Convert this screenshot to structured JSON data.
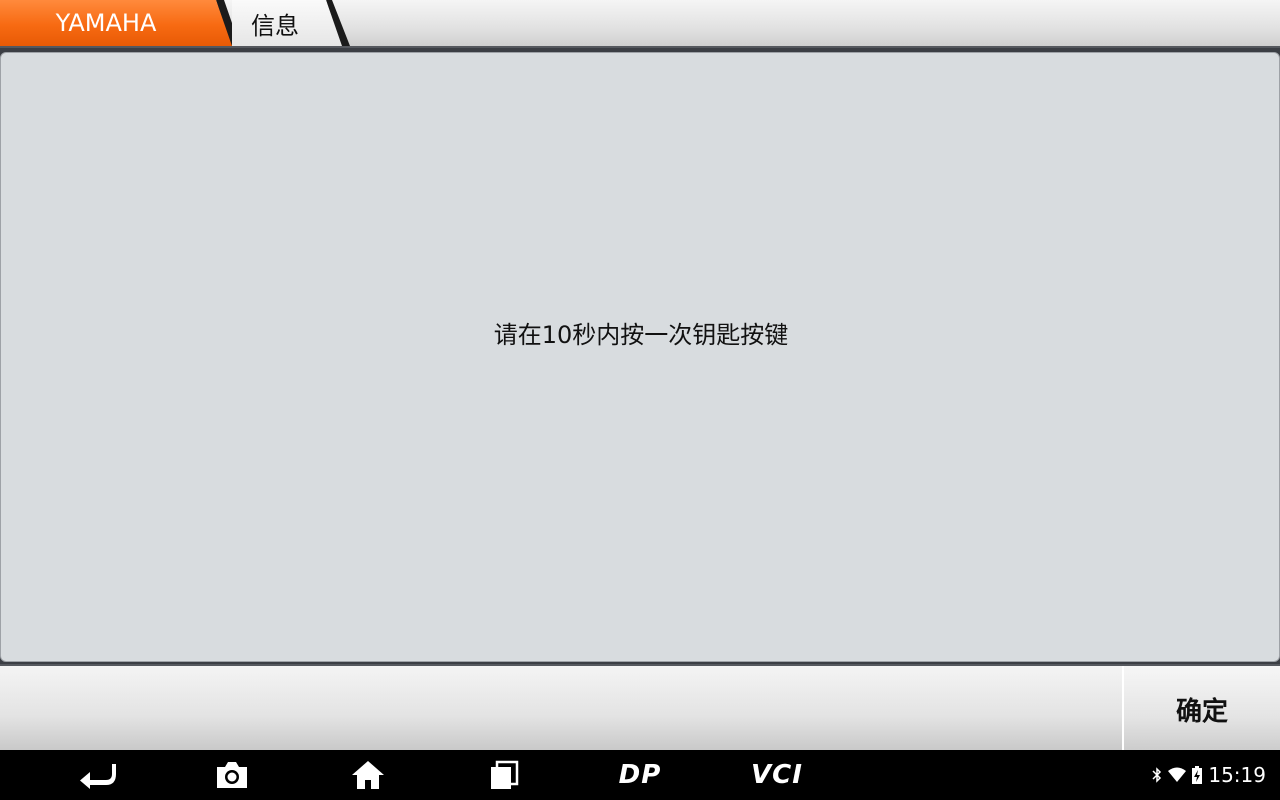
{
  "breadcrumb": {
    "items": [
      {
        "label": "YAMAHA",
        "color": "#f76a12"
      },
      {
        "label": "信息"
      }
    ]
  },
  "main": {
    "message": "请在10秒内按一次钥匙按键"
  },
  "actions": {
    "confirm_label": "确定"
  },
  "navbar": {
    "buttons": [
      "back-icon",
      "camera-icon",
      "home-icon",
      "recents-icon",
      "dp-icon",
      "vci-icon"
    ],
    "dp_label": "DP",
    "vci_label": "VCI"
  },
  "status_bar": {
    "time": "15:19",
    "icons": [
      "bluetooth-icon",
      "wifi-icon",
      "battery-charging-icon"
    ]
  }
}
